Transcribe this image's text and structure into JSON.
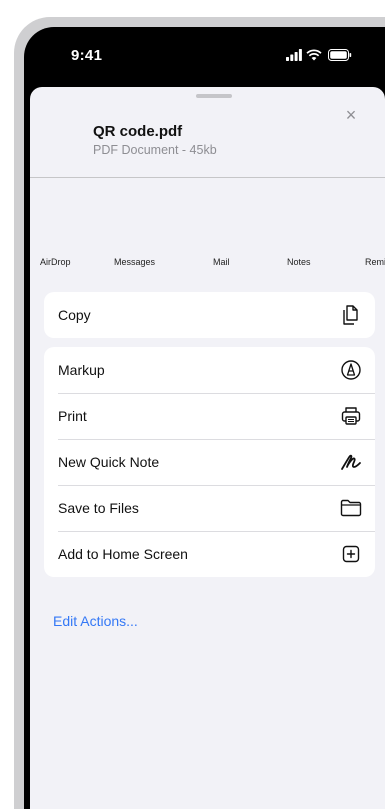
{
  "status_bar": {
    "time": "9:41"
  },
  "sheet": {
    "file_name": "QR code.pdf",
    "file_details": "PDF Document - 45kb",
    "close_label": "×",
    "share_targets": [
      "AirDrop",
      "Messages",
      "Mail",
      "Notes",
      "Remir"
    ],
    "copy_label": "Copy",
    "actions": [
      {
        "label": "Markup",
        "icon": "markup-icon"
      },
      {
        "label": "Print",
        "icon": "printer-icon"
      },
      {
        "label": "New Quick Note",
        "icon": "quick-note-icon"
      },
      {
        "label": "Save to Files",
        "icon": "folder-icon"
      },
      {
        "label": "Add to Home Screen",
        "icon": "add-square-icon"
      }
    ],
    "edit_actions_label": "Edit Actions..."
  },
  "colors": {
    "accent": "#3478f6",
    "sheet_background": "#f2f2f7",
    "device_frame": "#cfcfd1"
  }
}
